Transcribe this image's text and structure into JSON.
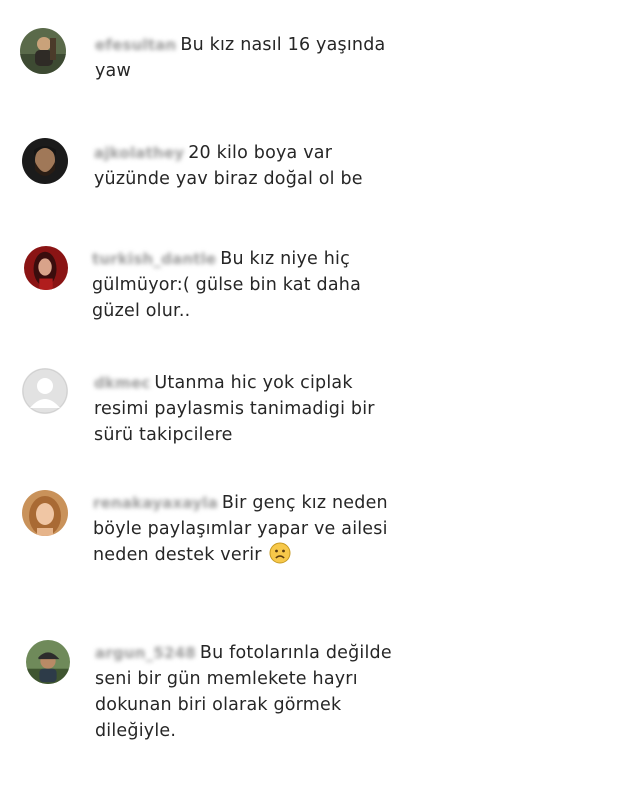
{
  "comments": [
    {
      "username": "efesultan",
      "text_lines": [
        "Bu kız nasıl 16 yaşında",
        "yaw"
      ],
      "avatar": "avatar-man-outdoors"
    },
    {
      "username": "ajkolathey",
      "text_lines": [
        "20 kilo boya var",
        "yüzünde yav biraz doğal ol be"
      ],
      "avatar": "avatar-bearded-man"
    },
    {
      "username": "turkish_dantle",
      "text_lines": [
        "Bu kız niye hiç",
        "gülmüyor:( gülse bin kat daha",
        "güzel olur.."
      ],
      "avatar": "avatar-woman-red"
    },
    {
      "username": "dkmec",
      "text_lines": [
        "Utanma hic yok ciplak",
        "resimi paylasmis tanimadigi bir",
        "sürü takipcilere"
      ],
      "avatar": "avatar-default"
    },
    {
      "username": "renakayaxayla",
      "text_lines": [
        "Bir genç kız neden",
        "böyle paylaşımlar yapar ve ailesi",
        "neden destek verir"
      ],
      "emoji": "sad-face-emoji",
      "avatar": "avatar-woman-blonde"
    },
    {
      "username": "argun_5248",
      "text_lines": [
        "Bu fotolarınla değilde",
        "seni bir gün memlekete hayrı",
        "dokunan biri olarak görmek",
        "dileğiyle."
      ],
      "avatar": "avatar-man-cap"
    }
  ]
}
